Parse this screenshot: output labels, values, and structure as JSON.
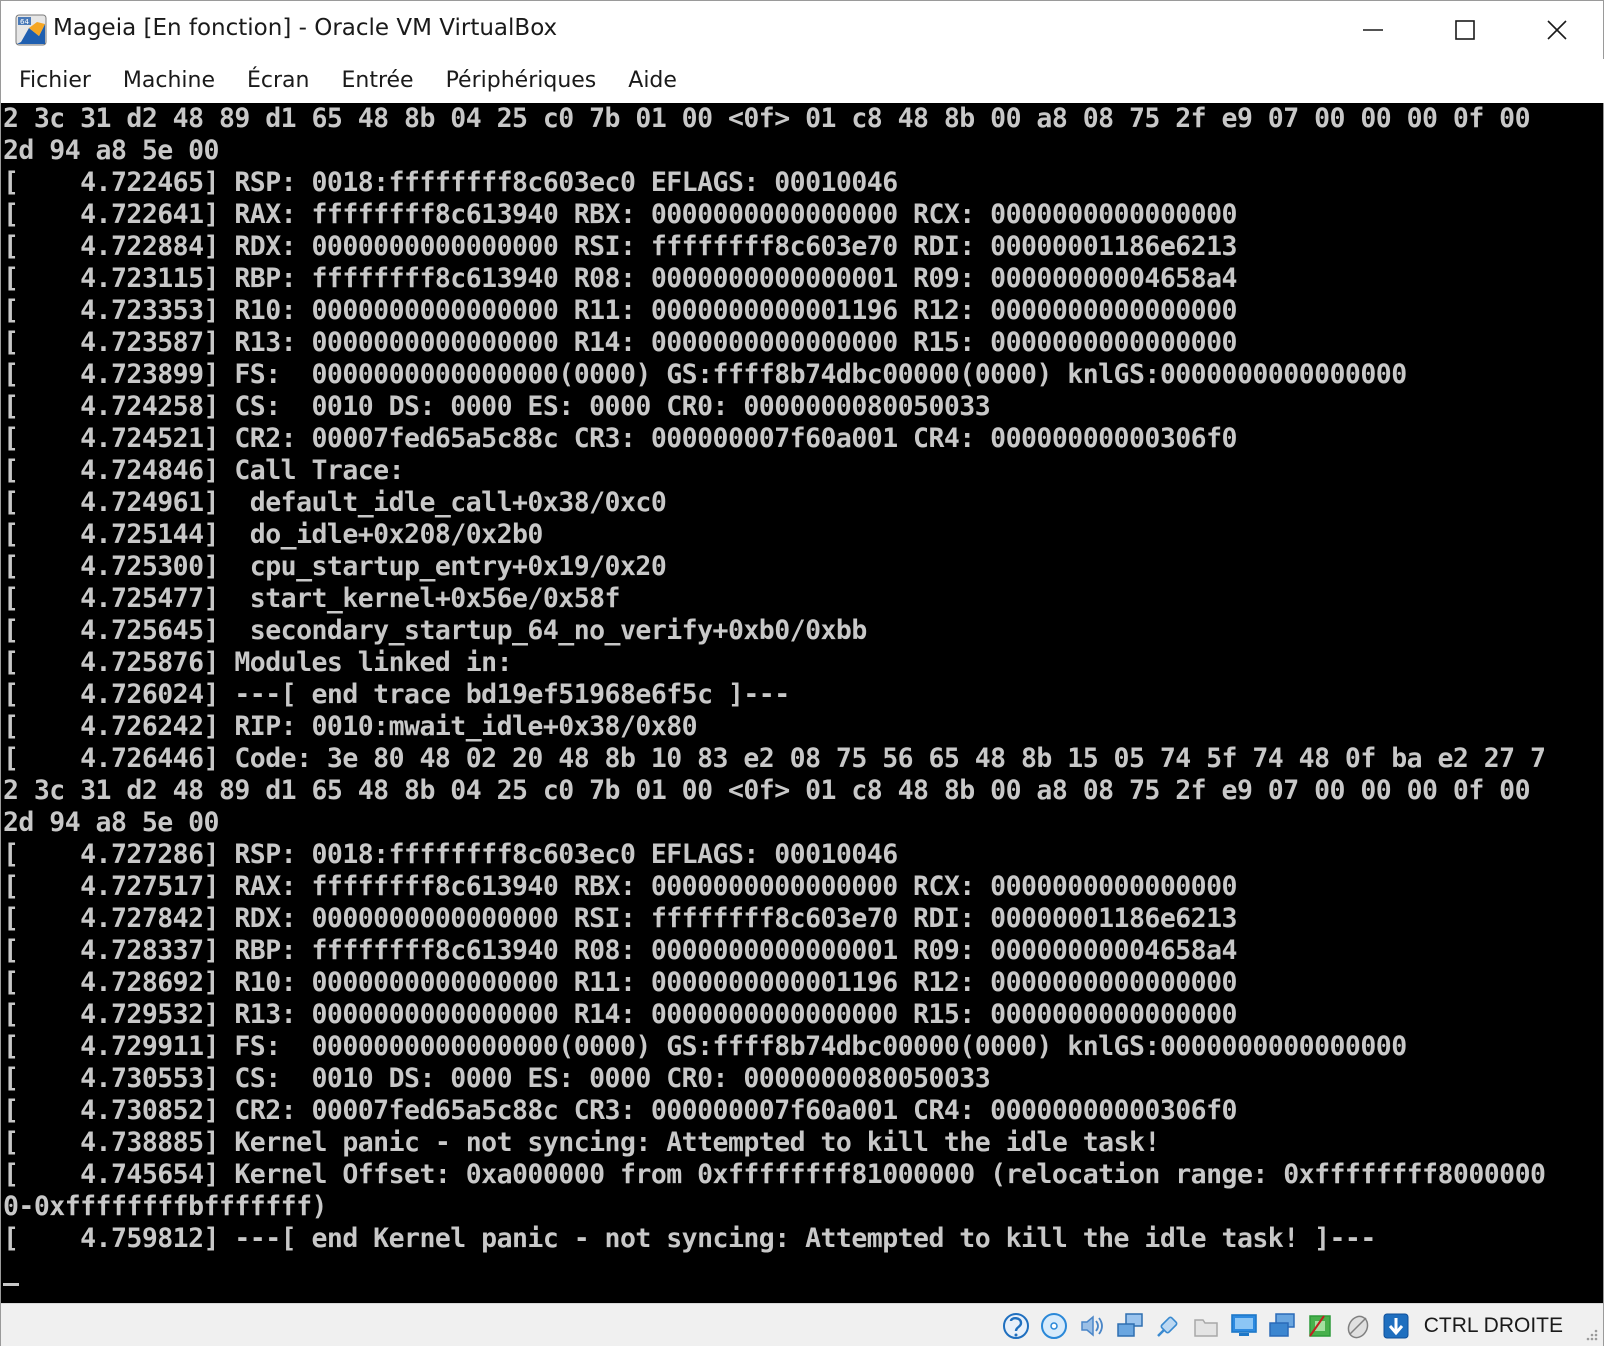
{
  "window": {
    "title": "Mageia [En fonction] - Oracle VM VirtualBox"
  },
  "menu": {
    "items": [
      {
        "label": "Fichier",
        "name": "menu-fichier"
      },
      {
        "label": "Machine",
        "name": "menu-machine"
      },
      {
        "label": "Écran",
        "name": "menu-ecran"
      },
      {
        "label": "Entrée",
        "name": "menu-entree"
      },
      {
        "label": "Périphériques",
        "name": "menu-peripheriques"
      },
      {
        "label": "Aide",
        "name": "menu-aide"
      }
    ]
  },
  "console": {
    "lines": [
      "2 3c 31 d2 48 89 d1 65 48 8b 04 25 c0 7b 01 00 <0f> 01 c8 48 8b 00 a8 08 75 2f e9 07 00 00 00 0f 00",
      "2d 94 a8 5e 00",
      "[    4.722465] RSP: 0018:ffffffff8c603ec0 EFLAGS: 00010046",
      "[    4.722641] RAX: ffffffff8c613940 RBX: 0000000000000000 RCX: 0000000000000000",
      "[    4.722884] RDX: 0000000000000000 RSI: ffffffff8c603e70 RDI: 00000001186e6213",
      "[    4.723115] RBP: ffffffff8c613940 R08: 0000000000000001 R09: 00000000004658a4",
      "[    4.723353] R10: 0000000000000000 R11: 0000000000001196 R12: 0000000000000000",
      "[    4.723587] R13: 0000000000000000 R14: 0000000000000000 R15: 0000000000000000",
      "[    4.723899] FS:  0000000000000000(0000) GS:ffff8b74dbc00000(0000) knlGS:0000000000000000",
      "[    4.724258] CS:  0010 DS: 0000 ES: 0000 CR0: 0000000080050033",
      "[    4.724521] CR2: 00007fed65a5c88c CR3: 000000007f60a001 CR4: 00000000000306f0",
      "[    4.724846] Call Trace:",
      "[    4.724961]  default_idle_call+0x38/0xc0",
      "[    4.725144]  do_idle+0x208/0x2b0",
      "[    4.725300]  cpu_startup_entry+0x19/0x20",
      "[    4.725477]  start_kernel+0x56e/0x58f",
      "[    4.725645]  secondary_startup_64_no_verify+0xb0/0xbb",
      "[    4.725876] Modules linked in:",
      "[    4.726024] ---[ end trace bd19ef51968e6f5c ]---",
      "[    4.726242] RIP: 0010:mwait_idle+0x38/0x80",
      "[    4.726446] Code: 3e 80 48 02 20 48 8b 10 83 e2 08 75 56 65 48 8b 15 05 74 5f 74 48 0f ba e2 27 7",
      "2 3c 31 d2 48 89 d1 65 48 8b 04 25 c0 7b 01 00 <0f> 01 c8 48 8b 00 a8 08 75 2f e9 07 00 00 00 0f 00",
      "2d 94 a8 5e 00",
      "[    4.727286] RSP: 0018:ffffffff8c603ec0 EFLAGS: 00010046",
      "[    4.727517] RAX: ffffffff8c613940 RBX: 0000000000000000 RCX: 0000000000000000",
      "[    4.727842] RDX: 0000000000000000 RSI: ffffffff8c603e70 RDI: 00000001186e6213",
      "[    4.728337] RBP: ffffffff8c613940 R08: 0000000000000001 R09: 00000000004658a4",
      "[    4.728692] R10: 0000000000000000 R11: 0000000000001196 R12: 0000000000000000",
      "[    4.729532] R13: 0000000000000000 R14: 0000000000000000 R15: 0000000000000000",
      "[    4.729911] FS:  0000000000000000(0000) GS:ffff8b74dbc00000(0000) knlGS:0000000000000000",
      "[    4.730553] CS:  0010 DS: 0000 ES: 0000 CR0: 0000000080050033",
      "[    4.730852] CR2: 00007fed65a5c88c CR3: 000000007f60a001 CR4: 00000000000306f0",
      "[    4.738885] Kernel panic - not syncing: Attempted to kill the idle task!",
      "[    4.745654] Kernel Offset: 0xa000000 from 0xffffffff81000000 (relocation range: 0xffffffff8000000",
      "0-0xffffffffbfffffff)",
      "[    4.759812] ---[ end Kernel panic - not syncing: Attempted to kill the idle task! ]---"
    ]
  },
  "statusbar": {
    "icons": [
      {
        "name": "hard-disk-icon",
        "color": "#1f6fbf"
      },
      {
        "name": "optical-drive-icon",
        "color": "#2a88d8"
      },
      {
        "name": "audio-icon",
        "color": "#4a86c8"
      },
      {
        "name": "network-icon",
        "color": "#2f6fb0"
      },
      {
        "name": "usb-icon",
        "color": "#3a8ad0"
      },
      {
        "name": "shared-folders-icon",
        "color": "#c0c0c0"
      },
      {
        "name": "display-icon",
        "color": "#1e78c8"
      },
      {
        "name": "video-capture-icon",
        "color": "#2a6ab8"
      },
      {
        "name": "cpu-indicator-icon",
        "color": "#2e9a3a"
      },
      {
        "name": "mouse-integration-icon",
        "color": "#808080"
      },
      {
        "name": "keyboard-capture-icon",
        "color": "#1f6fbf"
      }
    ],
    "host_key": "CTRL DROITE"
  },
  "colors": {
    "console_bg": "#000000",
    "console_fg": "#c8c8c8",
    "chrome_bg": "#ffffff",
    "statusbar_bg": "#f0f0f0"
  }
}
